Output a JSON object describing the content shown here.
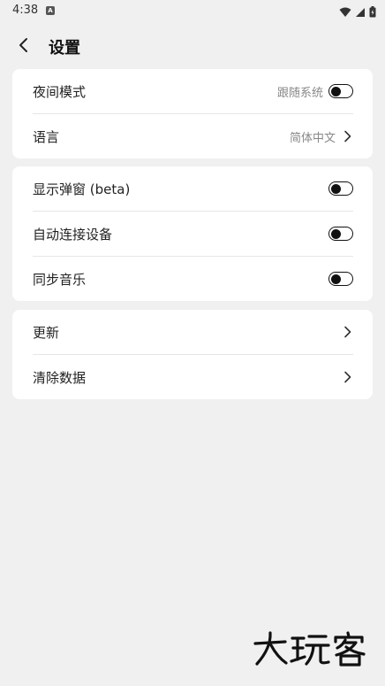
{
  "status_bar": {
    "time": "4:38",
    "notification_icon": "A"
  },
  "header": {
    "back_icon": "back-arrow-icon",
    "title": "设置"
  },
  "card1": {
    "night_mode": {
      "label": "夜间模式",
      "value": "跟随系统",
      "toggle_on": false
    },
    "language": {
      "label": "语言",
      "value": "简体中文"
    }
  },
  "card2": {
    "popup": {
      "label": "显示弹窗 (beta)",
      "toggle_on": false
    },
    "auto_connect": {
      "label": "自动连接设备",
      "toggle_on": false
    },
    "sync_music": {
      "label": "同步音乐",
      "toggle_on": false
    }
  },
  "card3": {
    "update": {
      "label": "更新"
    },
    "clear_data": {
      "label": "清除数据"
    }
  },
  "watermark": "大玩客",
  "colors": {
    "background": "#f0f0f0",
    "card": "#ffffff",
    "toggle": "#111111"
  }
}
